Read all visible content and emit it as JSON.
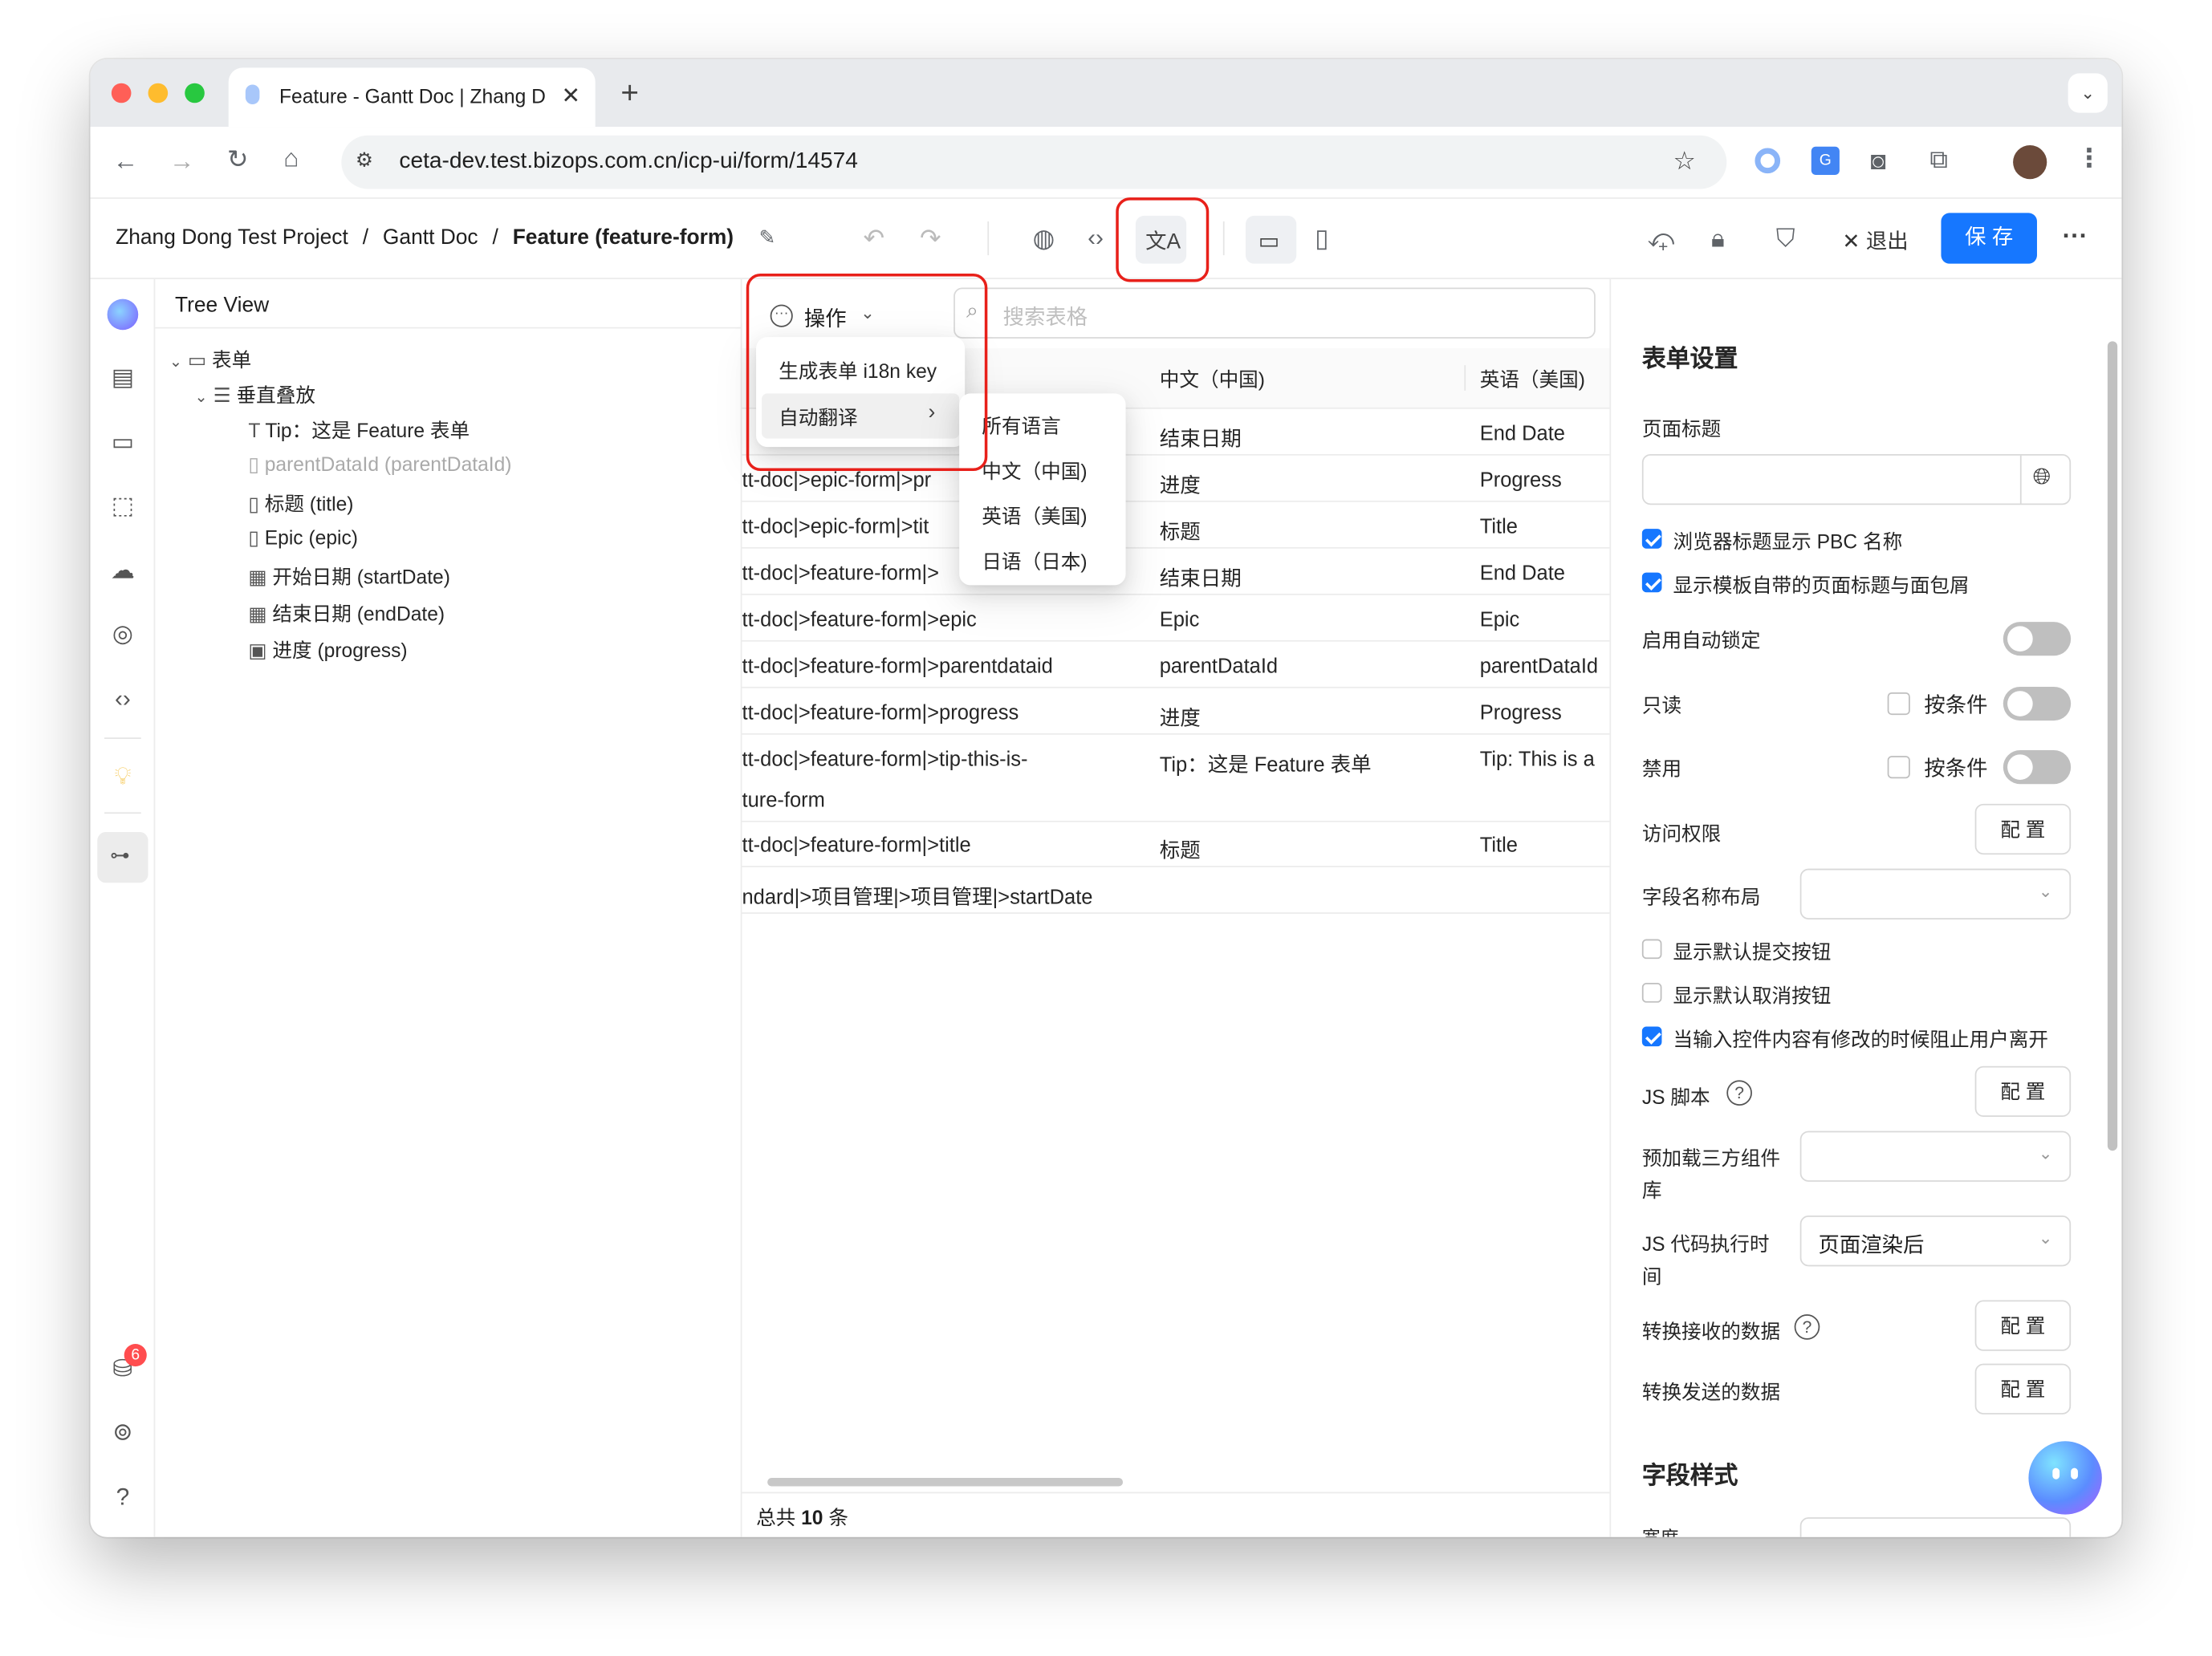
{
  "browser": {
    "tab_title": "Feature - Gantt Doc | Zhang D",
    "url": "ceta-dev.test.bizops.com.cn/icp-ui/form/14574"
  },
  "breadcrumb": {
    "project": "Zhang Dong Test Project",
    "sep1": "/",
    "doc": "Gantt Doc",
    "sep2": "/",
    "current": "Feature (feature-form)"
  },
  "appbar": {
    "exit_label": "退出",
    "save_label": "保 存"
  },
  "tree": {
    "title": "Tree View",
    "items": [
      {
        "label": "表单"
      },
      {
        "label": "垂直叠放"
      },
      {
        "label": "Tip：这是 Feature 表单"
      },
      {
        "label": "parentDataId (parentDataId)"
      },
      {
        "label": "标题 (title)"
      },
      {
        "label": "Epic (epic)"
      },
      {
        "label": "开始日期 (startDate)"
      },
      {
        "label": "结束日期 (endDate)"
      },
      {
        "label": "进度 (progress)"
      }
    ]
  },
  "center": {
    "actions_label": "操作",
    "search_placeholder": "搜索表格",
    "columns": [
      "中文（中国)",
      "英语（美国)"
    ],
    "rows": [
      {
        "key": "",
        "zh": "结束日期",
        "en": "End Date"
      },
      {
        "key": "tt-doc|>epic-form|>pr",
        "zh": "进度",
        "en": "Progress"
      },
      {
        "key": "tt-doc|>epic-form|>tit",
        "zh": "标题",
        "en": "Title"
      },
      {
        "key": "tt-doc|>feature-form|>",
        "zh": "结束日期",
        "en": "End Date"
      },
      {
        "key": "tt-doc|>feature-form|>epic",
        "zh": "Epic",
        "en": "Epic"
      },
      {
        "key": "tt-doc|>feature-form|>parentdataid",
        "zh": "parentDataId",
        "en": "parentDataId"
      },
      {
        "key": "tt-doc|>feature-form|>progress",
        "zh": "进度",
        "en": "Progress"
      },
      {
        "key": "tt-doc|>feature-form|>tip-this-is-",
        "key2": "ture-form",
        "zh": "Tip：这是 Feature 表单",
        "en": "Tip: This is a"
      },
      {
        "key": "tt-doc|>feature-form|>title",
        "zh": "标题",
        "en": "Title"
      },
      {
        "key": "ndard|>项目管理|>项目管理|>startDate",
        "zh": "",
        "en": ""
      }
    ],
    "footer_prefix": "总共",
    "footer_count": "10",
    "footer_suffix": "条"
  },
  "dropdown": {
    "items": [
      "生成表单 i18n key",
      "自动翻译"
    ],
    "submenu": [
      "所有语言",
      "中文（中国)",
      "英语（美国)",
      "日语（日本)"
    ]
  },
  "settings": {
    "title": "表单设置",
    "page_title_label": "页面标题",
    "cb1": "浏览器标题显示 PBC 名称",
    "cb2": "显示模板自带的页面标题与面包屑",
    "auto_lock": "启用自动锁定",
    "readonly": "只读",
    "by_condition": "按条件",
    "disabled": "禁用",
    "access": "访问权限",
    "config": "配 置",
    "field_layout": "字段名称布局",
    "cb3": "显示默认提交按钮",
    "cb4": "显示默认取消按钮",
    "cb5": "当输入控件内容有修改的时候阻止用户离开",
    "js_script": "JS 脚本",
    "preload_l1": "预加载三方组件",
    "preload_l2": "库",
    "js_exec_l1": "JS 代码执行时",
    "js_exec_l2": "间",
    "js_exec_value": "页面渲染后",
    "transform_recv": "转换接收的数据",
    "transform_send": "转换发送的数据",
    "field_style": "字段样式",
    "width_label": "宽度"
  },
  "badge_count": "6"
}
